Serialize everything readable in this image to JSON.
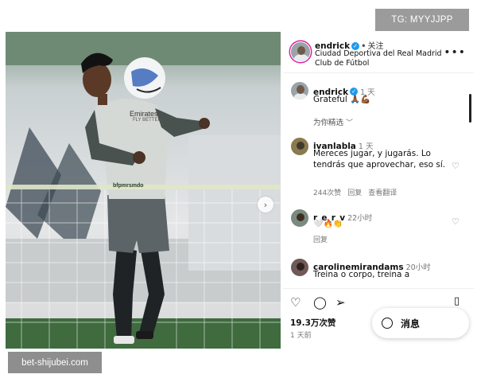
{
  "watermarks": {
    "top": "TG: MYYJJPP",
    "bottom": "bet-shijubei.com"
  },
  "photo": {
    "sponsor": "Emirates",
    "sponsor2": "FLY BETTER",
    "banner": "bfpmrsmdo"
  },
  "post": {
    "author": "endrick",
    "follow": "关注",
    "location": "Ciudad Deportiva del Real Madrid Club de Fútbol",
    "more_icon": "more-horizontal-icon"
  },
  "caption": {
    "user": "endrick",
    "time": "1 天",
    "text": "Grateful 🙏🏾💪🏾",
    "filter": "为你精选"
  },
  "comments": [
    {
      "user": "ivanlabla",
      "time": "1 天",
      "text": "Mereces jugar, y jugarás. Lo tendrás que aprovechar, eso sí.",
      "likes": "244次赞",
      "reply": "回复",
      "view_translation": "查看翻译"
    },
    {
      "user": "r_e_r_v",
      "time": "22小时",
      "text": "🤍🔥👏",
      "reply": "回复"
    },
    {
      "user": "carolinemirandams",
      "time": "20小时",
      "text": "Treina o corpo, treina a"
    }
  ],
  "actions": {
    "likes": "19.3万次赞",
    "time_ago": "1 天前",
    "messages": "消息"
  },
  "colors": {
    "verified": "#1d9bf0",
    "watermark_bg": "#9b9b9b"
  }
}
